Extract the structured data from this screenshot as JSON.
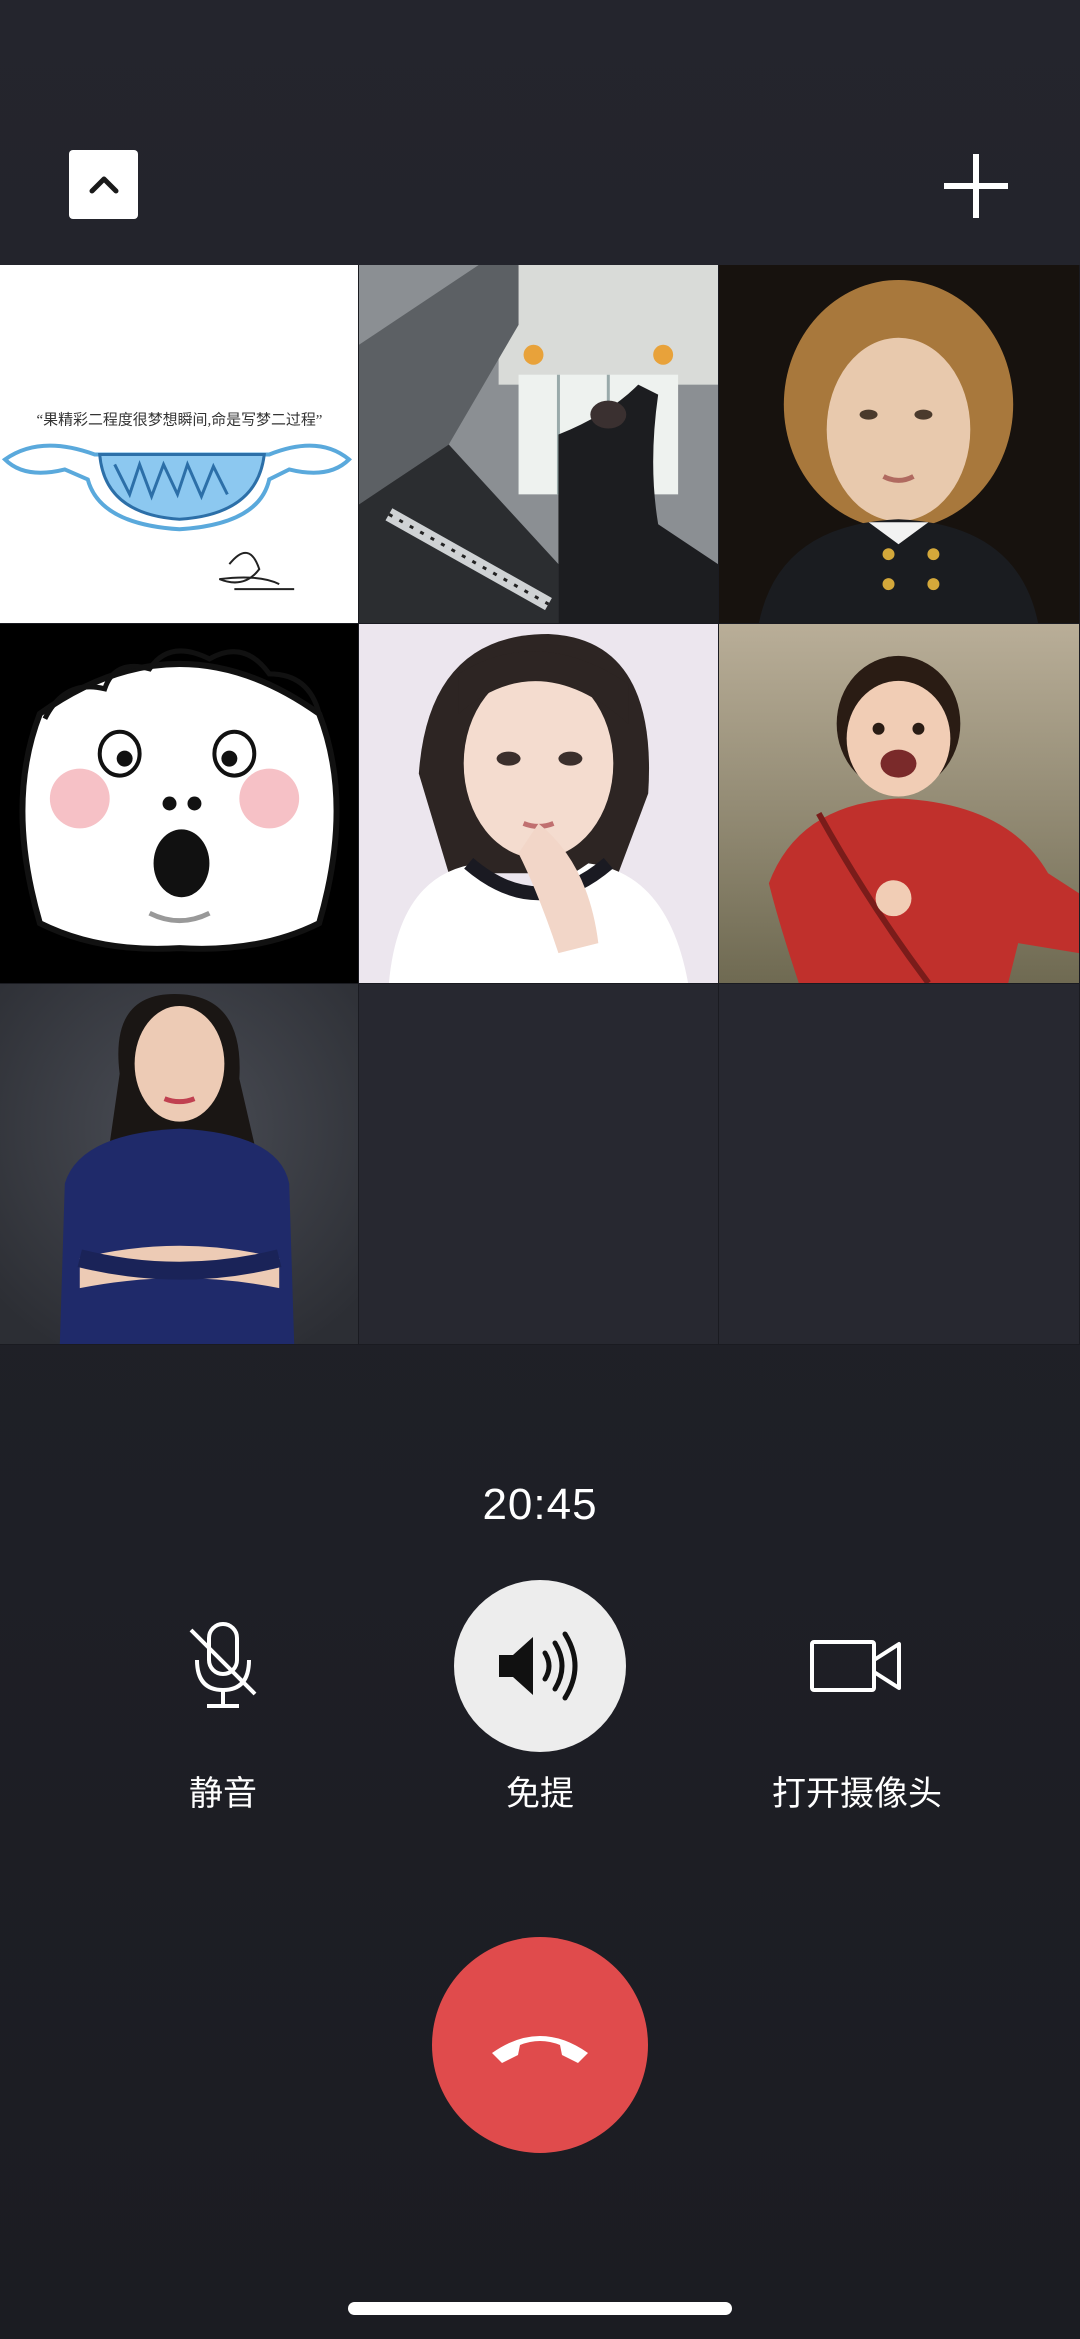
{
  "call": {
    "duration": "20:45"
  },
  "top_bar": {
    "collapse_icon": "chevron-up-icon",
    "add_icon": "plus-icon"
  },
  "participants": [
    {
      "avatar": "mask-doodle-avatar",
      "caption": "“果精彩二程度很梦想瞬间,命是写梦二过程”"
    },
    {
      "avatar": "piano-player-avatar"
    },
    {
      "avatar": "curly-hair-boy-avatar"
    },
    {
      "avatar": "surprised-cartoon-avatar"
    },
    {
      "avatar": "girl-selfie-avatar"
    },
    {
      "avatar": "laughing-child-avatar"
    },
    {
      "avatar": "woman-blue-dress-avatar"
    }
  ],
  "controls": {
    "mute_label": "静音",
    "speaker_label": "免提",
    "camera_label": "打开摄像头"
  },
  "colors": {
    "hangup": "#e04b4c",
    "speaker_active": "#ededed",
    "background": "#22232b"
  }
}
